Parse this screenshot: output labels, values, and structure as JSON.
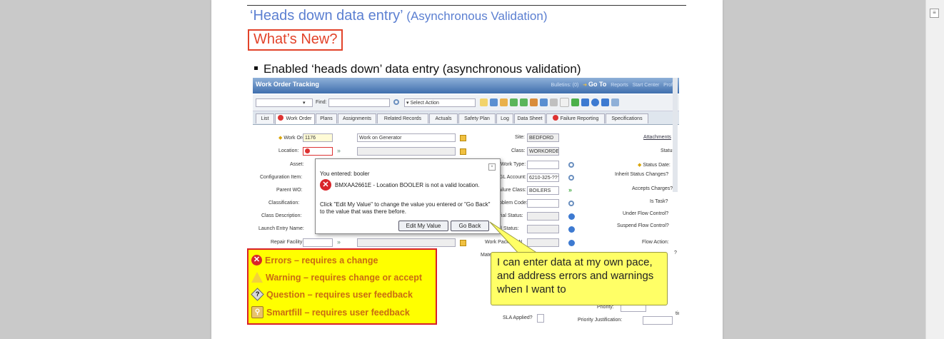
{
  "slide": {
    "title": "‘Heads down data entry’",
    "title_sub": " (Asynchronous  Validation)",
    "whats_new": "What’s New?",
    "bullet": "Enabled ‘heads down’ data entry (asynchronous validation)"
  },
  "app": {
    "window_title": "Work Order Tracking",
    "top_links": {
      "bulletins": "Bulletins: (0)",
      "goto": "Go To",
      "reports": "Reports",
      "start_center": "Start Center",
      "profile": "Profile"
    },
    "toolbar": {
      "find_label": "Find:",
      "select_action": "Select Action"
    },
    "tabs": [
      "List",
      "Work Order",
      "Plans",
      "Assignments",
      "Related Records",
      "Actuals",
      "Safety Plan",
      "Log",
      "Data Sheet",
      "Failure Reporting",
      "Specifications"
    ],
    "left_fields": {
      "work_order_label": "Work Order:",
      "work_order_value": "1176",
      "work_order_desc": "Work on Generator",
      "location_label": "Location:",
      "asset_label": "Asset:",
      "config_item_label": "Configuration Item:",
      "parent_wo_label": "Parent WO:",
      "classification_label": "Classification:",
      "class_desc_label": "Class Description:",
      "launch_entry_label": "Launch Entry Name:",
      "repair_facility_label": "Repair Facility:"
    },
    "mid_fields": {
      "site_label": "Site:",
      "site_value": "BEDFORD",
      "class_label": "Class:",
      "class_value": "WORKORDE",
      "work_type_label": "Work Type:",
      "gl_account_label": "GL Account:",
      "gl_account_value": "6210-325-???",
      "failure_class_label": "Failure Class:",
      "failure_class_value": "BOILERS",
      "problem_code_label": "Problem Code:",
      "storeroom_label": "oreroom Material Status:",
      "material_status_label": "Material Status:",
      "work_package_label": "Work Package N",
      "materi_label": "Materi",
      "sla_label": "SLA Applied?"
    },
    "right_fields": {
      "attachments": "Attachments",
      "status": "Status:",
      "status_date": "Status Date:",
      "inherit": "Inherit Status Changes?",
      "accepts": "Accepts Charges?",
      "is_task": "Is Task?",
      "under_flow": "Under Flow Control?",
      "suspend_flow": "Suspend Flow Control?",
      "flow_action": "Flow Action:",
      "tion": "tion",
      "priority": "Priority:",
      "priority_just": "Priority Justification:"
    },
    "popup": {
      "entered": "You entered: booler",
      "message": "BMXAA2661E - Location BOOLER is not a valid location.",
      "hint": "Click \"Edit My Value\" to change the value you entered or \"Go Back\" to the value that was there before.",
      "edit_button": "Edit My Value",
      "back_button": "Go Back"
    },
    "details_stub": "etails"
  },
  "legend": {
    "errors": "Errors – requires a change",
    "warning": "Warning – requires change or accept",
    "question": "Question – requires user feedback",
    "smartfill": "Smartfill – requires user feedback"
  },
  "callout": {
    "text": "I can enter data at my own pace, and address errors and warnings when I want to"
  },
  "colors": {
    "title_blue": "#5b7fd1",
    "accent_red": "#e2432a",
    "legend_yellow": "#ffff00",
    "legend_text": "#c96c12",
    "callout_yellow": "#ffff66"
  }
}
